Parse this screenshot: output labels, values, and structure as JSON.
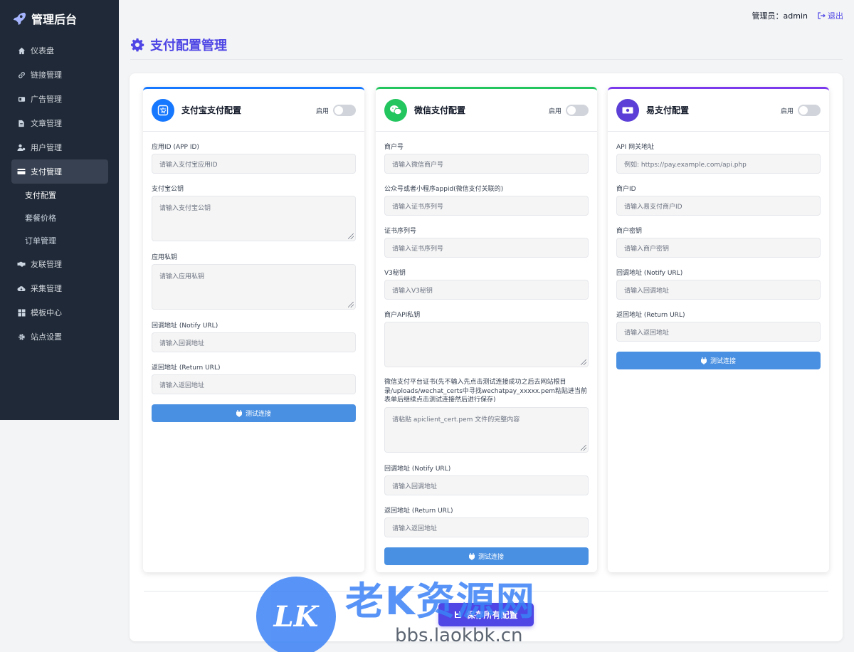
{
  "brand": {
    "title": "管理后台"
  },
  "sidebar": {
    "items": [
      {
        "label": "仪表盘",
        "icon": "home-icon"
      },
      {
        "label": "链接管理",
        "icon": "link-icon"
      },
      {
        "label": "广告管理",
        "icon": "ad-icon"
      },
      {
        "label": "文章管理",
        "icon": "file-icon"
      },
      {
        "label": "用户管理",
        "icon": "users-icon"
      },
      {
        "label": "支付管理",
        "icon": "credit-card-icon",
        "active": true
      },
      {
        "label": "友联管理",
        "icon": "handshake-icon"
      },
      {
        "label": "采集管理",
        "icon": "cloud-download-icon"
      },
      {
        "label": "模板中心",
        "icon": "grid-icon"
      },
      {
        "label": "站点设置",
        "icon": "gear-icon"
      }
    ],
    "sub_items": [
      {
        "label": "支付配置",
        "active": true
      },
      {
        "label": "套餐价格"
      },
      {
        "label": "订单管理"
      }
    ]
  },
  "topbar": {
    "admin_label": "管理员：admin",
    "logout_label": "退出"
  },
  "page": {
    "title": "支付配置管理"
  },
  "alipay": {
    "title": "支付宝支付配置",
    "toggle_label": "启用",
    "color": "#1677ff",
    "fields": {
      "app_id_label": "应用ID (APP ID)",
      "app_id_placeholder": "请输入支付宝应用ID",
      "public_key_label": "支付宝公钥",
      "public_key_placeholder": "请输入支付宝公钥",
      "private_key_label": "应用私钥",
      "private_key_placeholder": "请输入应用私钥",
      "notify_label": "回调地址 (Notify URL)",
      "notify_placeholder": "请输入回调地址",
      "return_label": "返回地址 (Return URL)",
      "return_placeholder": "请输入返回地址"
    },
    "test_label": "测试连接"
  },
  "wechat": {
    "title": "微信支付配置",
    "toggle_label": "启用",
    "color": "#22c55e",
    "fields": {
      "mch_label": "商户号",
      "mch_placeholder": "请输入微信商户号",
      "appid_label": "公众号或者小程序appid(微信支付关联的)",
      "appid_placeholder": "请输入证书序列号",
      "serial_label": "证书序列号",
      "serial_placeholder": "请输入证书序列号",
      "v3_label": "V3秘钥",
      "v3_placeholder": "请输入V3秘钥",
      "api_key_label": "商户API私钥",
      "api_key_placeholder": "",
      "cert_note": "微信支付平台证书(先不输入先点击测试连接成功之后去网站根目录/uploads/wechat_certs中寻找wechatpay_xxxxx.pem粘贴进当前表单后继续点击测试连接然后进行保存)",
      "cert_placeholder": "请粘贴 apiclient_cert.pem 文件的完整内容",
      "notify_label": "回调地址 (Notify URL)",
      "notify_placeholder": "请输入回调地址",
      "return_label": "返回地址 (Return URL)",
      "return_placeholder": "请输入返回地址"
    },
    "test_label": "测试连接"
  },
  "epay": {
    "title": "易支付配置",
    "toggle_label": "启用",
    "color": "#7c3aed",
    "fields": {
      "gateway_label": "API 网关地址",
      "gateway_placeholder": "例如: https://pay.example.com/api.php",
      "pid_label": "商户ID",
      "pid_placeholder": "请输入易支付商户ID",
      "key_label": "商户密钥",
      "key_placeholder": "请输入商户密钥",
      "notify_label": "回调地址 (Notify URL)",
      "notify_placeholder": "请输入回调地址",
      "return_label": "返回地址 (Return URL)",
      "return_placeholder": "请输入返回地址"
    },
    "test_label": "测试连接"
  },
  "save_label": "保存所有配置",
  "watermark": {
    "logo": "LK",
    "title": "老K资源网",
    "url": "bbs.laokbk.cn"
  }
}
